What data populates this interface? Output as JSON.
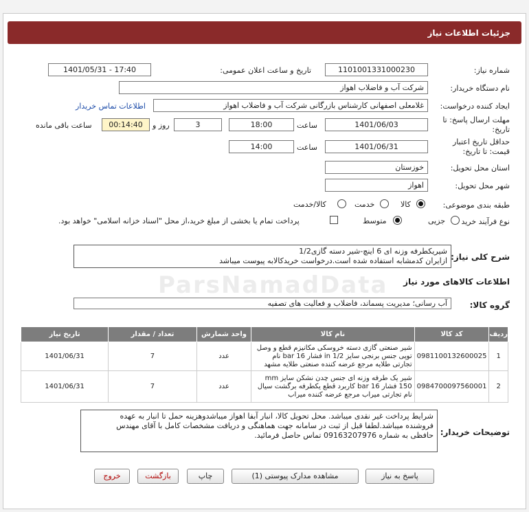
{
  "header": {
    "title": "جزئیات اطلاعات نیاز"
  },
  "form": {
    "need_number_label": "شماره نیاز:",
    "need_number": "1101001331000230",
    "announce_label": "تاریخ و ساعت اعلان عمومی:",
    "announce_value": "1401/05/31 - 17:40",
    "buyer_org_label": "نام دستگاه خریدار:",
    "buyer_org": "شرکت آب و فاضلاب اهواز",
    "creator_label": "ایجاد کننده درخواست:",
    "creator": "غلامعلی اصفهانی کارشناس بازرگانی شرکت آب و فاضلاب اهواز",
    "contact_link": "اطلاعات تماس خریدار",
    "deadline_label_1": "مهلت ارسال پاسخ: تا",
    "deadline_label_2": "تاریخ:",
    "deadline_date": "1401/06/03",
    "time_label": "ساعت",
    "deadline_time": "18:00",
    "days_value": "3",
    "days_label": "روز و",
    "remaining_time": "00:14:40",
    "remaining_label": "ساعت باقی مانده",
    "validity_label_1": "حداقل تاریخ اعتبار",
    "validity_label_2": "قیمت: تا تاریخ:",
    "validity_date": "1401/06/31",
    "validity_time_label": "ساعت",
    "validity_time": "14:00",
    "province_label": "استان محل تحویل:",
    "province": "خوزستان",
    "city_label": "شهر محل تحویل:",
    "city": "اهواز",
    "category_label": "طبقه بندی موضوعی:",
    "category_options": {
      "goods": "کالا",
      "service": "خدمت",
      "goods_service": "کالا/خدمت"
    },
    "process_label": "نوع فرآیند خرید :",
    "process_options": {
      "minor": "جزیی",
      "medium": "متوسط"
    },
    "payment_note": "پرداخت تمام یا بخشی از مبلغ خرید،از محل \"اسناد خزانه اسلامی\" خواهد بود."
  },
  "general_desc": {
    "label": "شرح کلی نیاز:",
    "line1": "شیریکطرفه وزنه ای 6 اینچ-شیر دسته گازی1/2",
    "line2": "ازایران کدمشابه استفاده شده است.درخواست خریدکالابه پیوست میباشد"
  },
  "goods_info": {
    "title": "اطلاعات کالاهای مورد نیاز",
    "group_label": "گروه کالا:",
    "group_value": "آب رسانی؛ مدیریت پسماند، فاضلاب و فعالیت های تصفیه"
  },
  "table": {
    "headers": {
      "row": "ردیف",
      "code": "کد کالا",
      "name": "نام کالا",
      "unit": "واحد شمارش",
      "qty": "تعداد / مقدار",
      "date": "تاریخ نیاز"
    },
    "rows": [
      {
        "row": "1",
        "code": "0981100132600025",
        "name": "شیر صنعتی گازی دسته خروسکی مکانیزم قطع و وصل توپی جنس برنجی سایز in 1/2 فشار bar 16 نام تجارتی طلایه مرجع عرضه کننده صنعتی طلایه مشهد",
        "unit": "عدد",
        "qty": "7",
        "date": "1401/06/31"
      },
      {
        "row": "2",
        "code": "0984700097560001",
        "name": "شیر یک طرفه وزنه ای جنس چدن نشکن سایز mm 150 فشار bar 16 کاربرد قطع یکطرفه برگشت سیال نام تجارتی میراب مرجع عرضه کننده میراب",
        "unit": "عدد",
        "qty": "7",
        "date": "1401/06/31"
      }
    ]
  },
  "buyer_notes": {
    "label": "توضیحات خریدار:",
    "line1": "شرایط پرداخت غیر نقدی میباشد. محل تحویل کالا، انبار آبفا اهواز میباشدوهزینه حمل تا انبار به عهده",
    "line2": "فروشنده میباشد.لطفا قبل از ثبت در سامانه جهت هماهنگی و دریافت مشخصات کامل با آقای مهندس",
    "line3": "حافظی به شماره   09163207976  تماس حاصل فرمائید."
  },
  "buttons": {
    "reply": "پاسخ به نیاز",
    "view_docs": "مشاهده مدارک پیوستی (1)",
    "print": "چاپ",
    "back": "بازگشت",
    "exit": "خروج"
  }
}
